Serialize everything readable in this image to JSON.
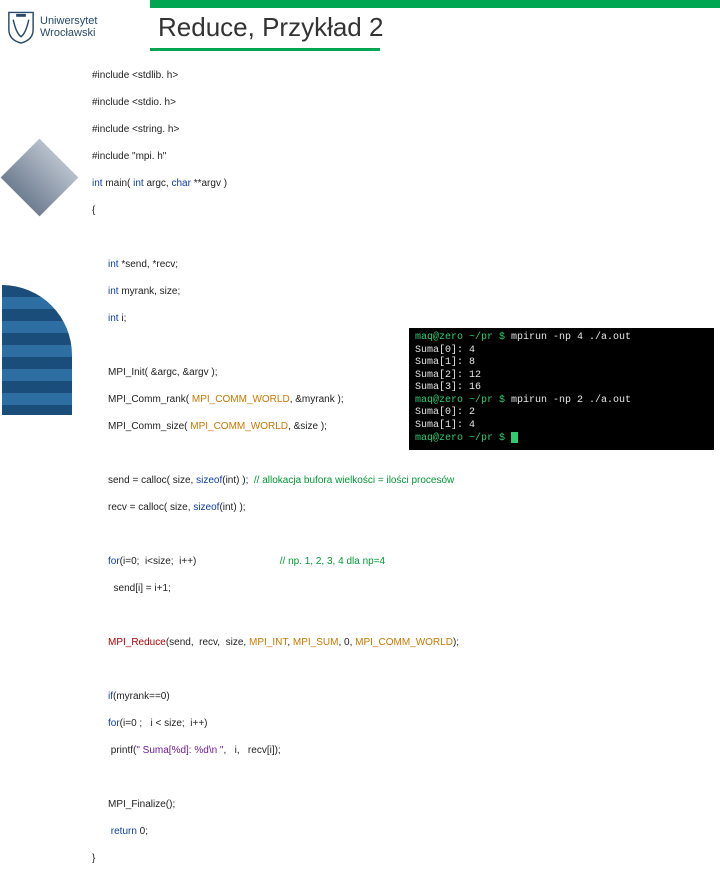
{
  "university": {
    "line1": "Uniwersytet",
    "line2": "Wrocławski"
  },
  "slide": {
    "title": "Reduce, Przykład 2"
  },
  "code": {
    "l01": "#include <stdlib. h>",
    "l02": "#include <stdio. h>",
    "l03": "#include <string. h>",
    "l04": "#include \"mpi. h\"",
    "l05a": "int",
    "l05b": " main( ",
    "l05c": "int",
    "l05d": " argc, ",
    "l05e": "char",
    "l05f": " **argv )",
    "l06": "{",
    "l07a": "int",
    "l07b": " *send, *recv;",
    "l08a": "int",
    "l08b": " myrank, size;",
    "l09a": "int",
    "l09b": " i;",
    "l10": "MPI_Init( &argc, &argv );",
    "l11a": "MPI_Comm_rank( ",
    "l11b": "MPI_COMM_WORLD",
    "l11c": ", &myrank );",
    "l12a": "MPI_Comm_size( ",
    "l12b": "MPI_COMM_WORLD",
    "l12c": ", &size );",
    "l13a": "send = calloc( size, ",
    "l13b": "sizeof",
    "l13c": "(int) );  ",
    "l13d": "// allokacja bufora wielkości = ilości procesów",
    "l14a": "recv = calloc( size, ",
    "l14b": "sizeof",
    "l14c": "(int) );",
    "l15a": "for",
    "l15b": "(i=0;  i<size;  i++)                              ",
    "l15c": "// np. 1, 2, 3, 4 dla np=4",
    "l16": "  send[i] = i+1;",
    "l17a": "MPI_Reduce",
    "l17b": "(send,  recv,  size, ",
    "l17c": "MPI_INT",
    "l17d": ", ",
    "l17e": "MPI_SUM",
    "l17f": ", 0, ",
    "l17g": "MPI_COMM_WORLD",
    "l17h": ");",
    "l18a": "if",
    "l18b": "(myrank==0)",
    "l19a": "for",
    "l19b": "(i=0 ;   i < size;  i++)",
    "l20a": " printf(",
    "l20b": "\" Suma[%d]: %d\\n \"",
    "l20c": ",   i,   recv[i]);",
    "l21": "MPI_Finalize();",
    "l22a": " return",
    "l22b": " 0;",
    "l23": "}"
  },
  "term": {
    "p1": "maq@zero ~/pr $ ",
    "c1": "mpirun -np 4 ./a.out",
    "o1": "Suma[0]: 4",
    "o2": "Suma[1]: 8",
    "o3": "Suma[2]: 12",
    "o4": "Suma[3]: 16",
    "p2": "maq@zero ~/pr $ ",
    "c2": "mpirun -np 2 ./a.out",
    "o5": "Suma[0]: 2",
    "o6": "Suma[1]: 4",
    "p3": "maq@zero ~/pr $ "
  }
}
